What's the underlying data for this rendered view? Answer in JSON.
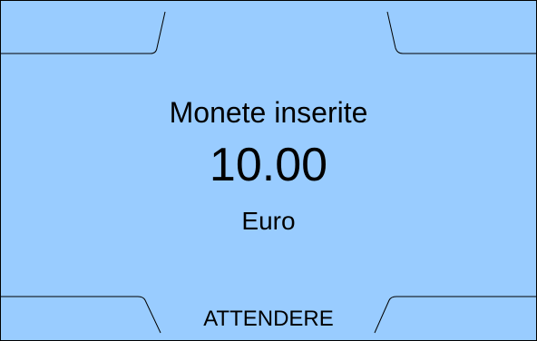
{
  "display": {
    "title": "Monete inserite",
    "amount": "10.00",
    "currency": "Euro",
    "status": "ATTENDERE"
  },
  "colors": {
    "background": "#99ccff",
    "text": "#000000",
    "lines": "#000000"
  }
}
